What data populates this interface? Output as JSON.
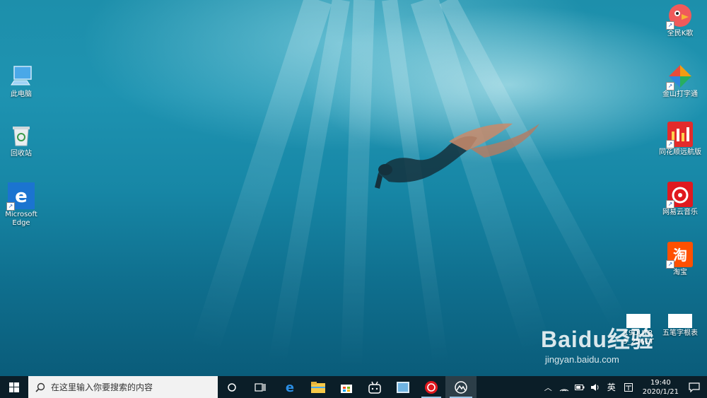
{
  "desktop": {
    "left_icons": [
      {
        "label": "此电脑",
        "icon": "computer-icon"
      },
      {
        "label": "回收站",
        "icon": "recycle-bin-icon"
      },
      {
        "label": "Microsoft\nEdge",
        "icon": "edge-icon"
      }
    ],
    "right_icons": [
      {
        "label": "全民K歌",
        "icon": "kge-icon"
      },
      {
        "label": "金山打字通",
        "icon": "typing-icon"
      },
      {
        "label": "同花顺远航版",
        "icon": "stock-icon"
      },
      {
        "label": "网易云音乐",
        "icon": "netease-music-icon"
      },
      {
        "label": "淘宝",
        "icon": "taobao-icon"
      },
      {
        "label": "五笔字根表",
        "icon": "document-icon"
      }
    ],
    "file_icon": {
      "label": "19DUTR\n3_256CT",
      "icon": "document-icon"
    }
  },
  "taskbar": {
    "search_placeholder": "在这里输入你要搜索的内容",
    "ime_label": "英",
    "time": "19:40",
    "date": "2020/1/21"
  },
  "watermark": {
    "logo": "Baidu经验",
    "url": "jingyan.baidu.com"
  }
}
